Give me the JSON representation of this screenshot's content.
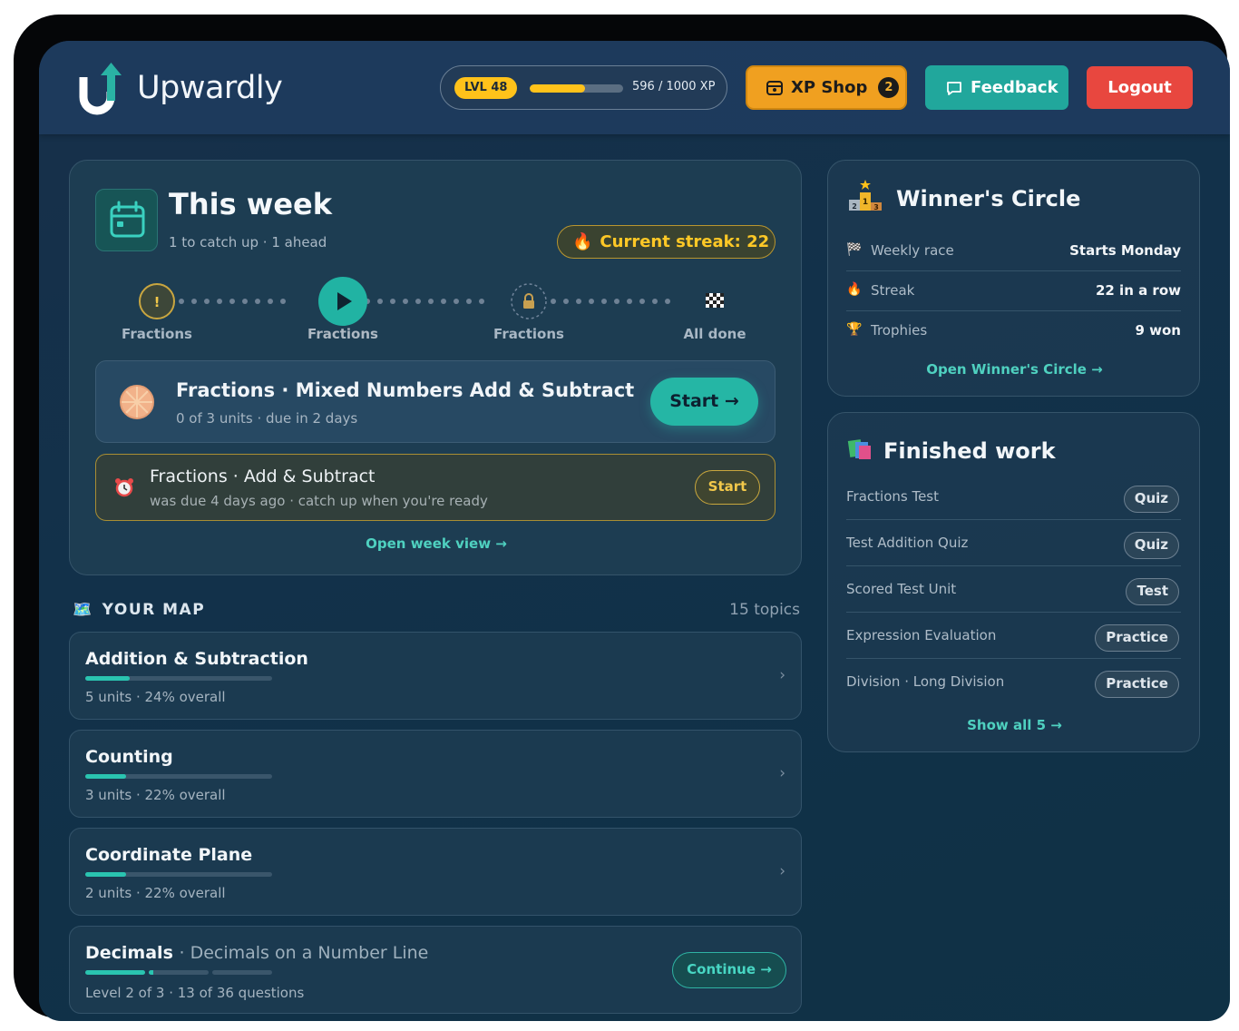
{
  "header": {
    "brand": "Upwardly",
    "level": "LVL 48",
    "xp_text": "596 / 1000 XP",
    "xp_progress": 0.596,
    "shop_label": "XP Shop",
    "shop_count": "2",
    "feedback_label": "Feedback",
    "logout_label": "Logout"
  },
  "week": {
    "title": "This week",
    "subtitle": "1 to catch up · 1 ahead",
    "streak": "Current streak: 22",
    "steps": [
      "Fractions",
      "Fractions",
      "Fractions",
      "All done"
    ],
    "next": {
      "title": "Fractions · Mixed Numbers Add & Subtract",
      "sub": "0 of 3 units · due in 2 days",
      "button": "Start →"
    },
    "late": {
      "title": "Fractions · Add & Subtract",
      "sub": "was due 4 days ago · catch up when you're ready",
      "button": "Start"
    },
    "link": "Open week view →"
  },
  "map": {
    "title": "YOUR MAP",
    "count": "15 topics",
    "topics": [
      {
        "name": "Addition & Subtraction",
        "meta": "5 units · 24% overall",
        "progress": 0.24
      },
      {
        "name": "Counting",
        "meta": "3 units · 22% overall",
        "progress": 0.22
      },
      {
        "name": "Coordinate Plane",
        "meta": "2 units · 22% overall",
        "progress": 0.22
      },
      {
        "name": "Decimals",
        "sub": "· Decimals on a Number Line",
        "meta": "Level 2 of 3 · 13 of 36 questions",
        "button": "Continue →"
      }
    ]
  },
  "winners": {
    "title": "Winner's Circle",
    "rows": [
      {
        "label": "Weekly race",
        "value": "Starts Monday"
      },
      {
        "label": "Streak",
        "value": "22 in a row"
      },
      {
        "label": "Trophies",
        "value": "9 won"
      }
    ],
    "link": "Open Winner's Circle →"
  },
  "finished": {
    "title": "Finished work",
    "rows": [
      {
        "label": "Fractions Test",
        "tag": "Quiz"
      },
      {
        "label": "Test Addition Quiz",
        "tag": "Quiz"
      },
      {
        "label": "Scored Test Unit",
        "tag": "Test"
      },
      {
        "label": "Expression Evaluation",
        "tag": "Practice"
      },
      {
        "label": "Division · Long Division",
        "tag": "Practice"
      }
    ],
    "link": "Show all 5 →"
  },
  "colors": {
    "accent": "#25b6a5",
    "gold": "#ffc21a",
    "danger": "#e8473f",
    "shop": "#f0a020"
  }
}
